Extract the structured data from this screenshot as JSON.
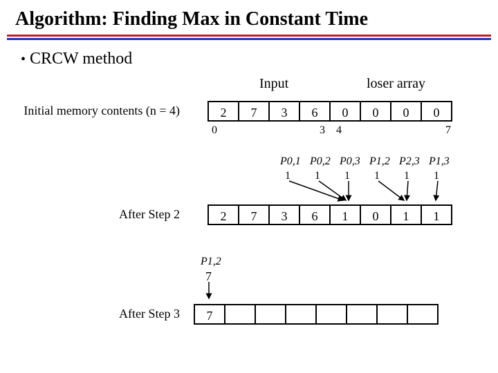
{
  "title": "Algorithm: Finding Max in Constant Time",
  "bullet": "CRCW method",
  "headers": {
    "input": "Input",
    "loser": "loser array"
  },
  "rows": {
    "initial": {
      "label": "Initial memory contents (n = 4)",
      "cells": [
        "2",
        "7",
        "3",
        "6",
        "0",
        "0",
        "0",
        "0"
      ],
      "indices": {
        "i0": "0",
        "i3": "3",
        "i4": "4",
        "i7": "7"
      }
    },
    "step2": {
      "label": "After Step 2",
      "cells": [
        "2",
        "7",
        "3",
        "6",
        "1",
        "0",
        "1",
        "1"
      ],
      "procs": [
        "P0,1",
        "P0,2",
        "P0,3",
        "P1,2",
        "P2,3",
        "P1,3"
      ],
      "ones": [
        "1",
        "1",
        "1",
        "1",
        "1",
        "1"
      ]
    },
    "step3": {
      "label": "After Step 3",
      "cells": [
        "7",
        "",
        "",
        "",
        "",
        "",
        "",
        ""
      ],
      "proc": "P1,2",
      "write": "7"
    }
  }
}
